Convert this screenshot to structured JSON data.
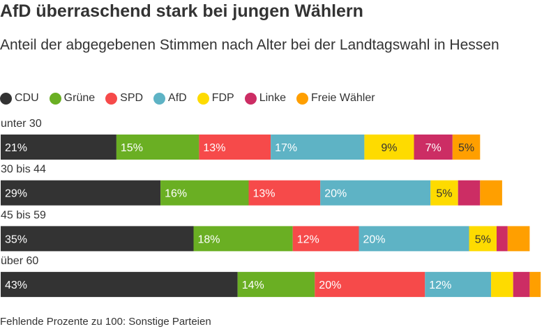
{
  "title": "AfD überraschend stark bei jungen Wählern",
  "subtitle": "Anteil der abgegebenen Stimmen nach Alter bei der Landtagswahl in Hessen",
  "footnote": "Fehlende Prozente zu 100: Sonstige Parteien",
  "chart_data": {
    "type": "bar",
    "orientation": "horizontal",
    "stacked": true,
    "unit": "%",
    "xlim": [
      0,
      100
    ],
    "title": "AfD überraschend stark bei jungen Wählern",
    "subtitle": "Anteil der abgegebenen Stimmen nach Alter bei der Landtagswahl in Hessen",
    "legend_position": "top-left",
    "categories": [
      "unter 30",
      "30 bis 44",
      "45 bis 59",
      "über 60"
    ],
    "series": [
      {
        "name": "CDU",
        "color": "#333333",
        "values": [
          21,
          29,
          35,
          43
        ],
        "labels": [
          "21%",
          "29%",
          "35%",
          "43%"
        ],
        "label_color": "#ffffff"
      },
      {
        "name": "Grüne",
        "color": "#6aaf23",
        "values": [
          15,
          16,
          18,
          14
        ],
        "labels": [
          "15%",
          "16%",
          "18%",
          "14%"
        ],
        "label_color": "#ffffff"
      },
      {
        "name": "SPD",
        "color": "#f64a4a",
        "values": [
          13,
          13,
          12,
          20
        ],
        "labels": [
          "13%",
          "13%",
          "12%",
          "20%"
        ],
        "label_color": "#ffffff"
      },
      {
        "name": "AfD",
        "color": "#5eb3c5",
        "values": [
          17,
          20,
          20,
          12
        ],
        "labels": [
          "17%",
          "20%",
          "20%",
          "12%"
        ],
        "label_color": "#ffffff"
      },
      {
        "name": "FDP",
        "color": "#fedb00",
        "values": [
          9,
          5,
          5,
          4
        ],
        "labels": [
          "9%",
          "5%",
          "5%",
          ""
        ],
        "label_color": "#333333"
      },
      {
        "name": "Linke",
        "color": "#cc2d64",
        "values": [
          7,
          4,
          2,
          3
        ],
        "labels": [
          "7%",
          "",
          "",
          ""
        ],
        "label_color": "#ffffff"
      },
      {
        "name": "Freie Wähler",
        "color": "#ff9f00",
        "values": [
          5,
          4,
          4,
          2
        ],
        "labels": [
          "5%",
          "",
          "",
          ""
        ],
        "label_color": "#333333"
      }
    ]
  }
}
